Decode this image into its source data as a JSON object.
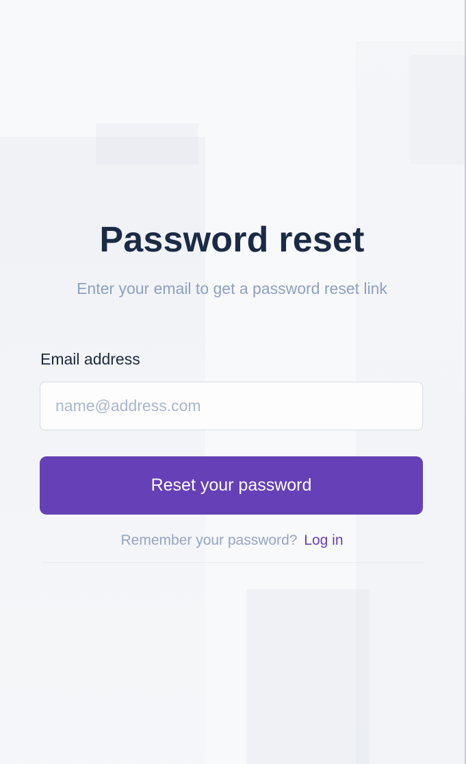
{
  "page": {
    "title": "Password reset",
    "subtitle": "Enter your email to get a password reset link"
  },
  "form": {
    "email_label": "Email address",
    "email_value": "",
    "email_placeholder": "name@address.com",
    "submit_label": "Reset your password"
  },
  "footer": {
    "prompt_text": "Remember your password?",
    "login_link": "Log in"
  },
  "colors": {
    "accent": "#6640b6",
    "title": "#1b2a45",
    "muted": "#8ea0bf",
    "background": "#f8f9fb"
  }
}
